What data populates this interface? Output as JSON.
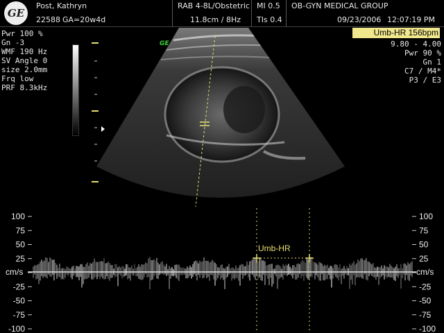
{
  "header": {
    "logo_text": "GE",
    "patient_name": "Post, Kathryn",
    "patient_id": "22588",
    "gestational_age": "GA=20w4d",
    "probe": "RAB 4-8L/Obstetric",
    "depth_rate": "11.8cm / 8Hz",
    "mi": "MI  0.5",
    "tis": "TIs  0.4",
    "institution": "OB-GYN MEDICAL GROUP",
    "date": "09/23/2006",
    "time": "12:07:19 PM"
  },
  "left_params": [
    "Pwr 100 %",
    "Gn  -3",
    "WMF 190 Hz",
    "SV Angle  0",
    "size  2.0mm",
    "Frq low",
    "PRF  8.3kHz"
  ],
  "right_params": [
    "9.80 - 4.00",
    "Pwr  90 %",
    "Gn   1",
    "C7 / M4*",
    "P3 / E3"
  ],
  "measurement_badge": "Umb-HR 156bpm",
  "image_mark": "GE",
  "doppler": {
    "label": "Umb-HR",
    "unit": "cm/s",
    "ticks_left": [
      "100",
      "75",
      "50",
      "25",
      "",
      "-25",
      "-50",
      "-75",
      "-100"
    ],
    "ticks_right": [
      "100",
      "75",
      "50",
      "25",
      "",
      "-25",
      "-50",
      "-75",
      "-100"
    ],
    "tick_values": [
      100,
      75,
      50,
      25,
      0,
      -25,
      -50,
      -75,
      -100
    ],
    "yrange": [
      -100,
      100
    ]
  },
  "colors": {
    "caliper": "#e8e070",
    "badge_bg": "#f0e68c",
    "ge_green": "#3bd23b"
  }
}
